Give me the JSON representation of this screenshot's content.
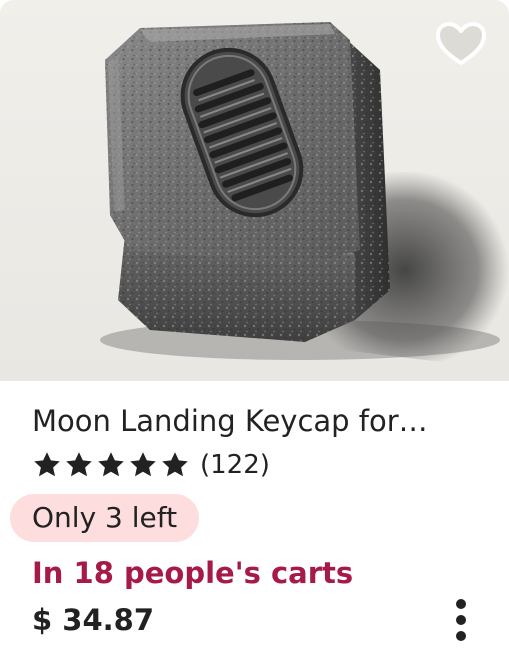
{
  "listing": {
    "title": "Moon Landing Keycap for…",
    "rating_stars": 5,
    "review_count": "(122)",
    "stock_badge": "Only 3 left",
    "carts_text": "In 18 people's carts",
    "price": "$ 34.87"
  },
  "image": {
    "subject": "grey stone-textured keycap with engraved boot print"
  },
  "icons": {
    "favorite": "heart-outline-icon",
    "rating": "star-icon",
    "more": "vertical-ellipsis-icon"
  },
  "colors": {
    "carts_text": "#a61a47",
    "stock_badge_bg": "#fddddd",
    "text": "#222222",
    "stars": "#222222"
  }
}
